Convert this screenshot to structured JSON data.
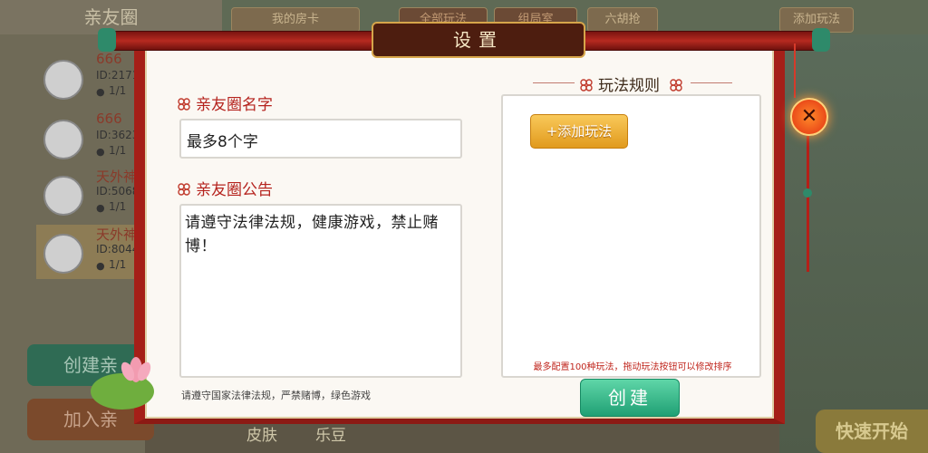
{
  "background": {
    "left_header": "亲友圈",
    "top_tabs": [
      "我的房卡",
      "全部玩法",
      "组局室",
      "六胡抢",
      "添加玩法"
    ],
    "members": [
      {
        "name": "666",
        "id": "ID:2171",
        "count": "1/1"
      },
      {
        "name": "666",
        "id": "ID:3623",
        "count": "1/1"
      },
      {
        "name": "天外神",
        "id": "ID:5068",
        "count": "1/1"
      },
      {
        "name": "天外神",
        "id": "ID:8044",
        "count": "1/1"
      }
    ],
    "create_circle_label": "创建亲",
    "join_circle_label": "加入亲",
    "bottom_labels": [
      "皮肤",
      "乐豆"
    ],
    "quick_start_label": "快速开始"
  },
  "dialog": {
    "title": "设置",
    "name_label": "亲友圈名字",
    "name_placeholder": "最多8个字",
    "notice_label": "亲友圈公告",
    "notice_text": "请遵守法律法规，健康游戏，禁止赌博！",
    "footnote": "请遵守国家法律法规，严禁赌博，绿色游戏",
    "rules_title": "玩法规则",
    "add_rule_label": "+添加玩法",
    "rules_note": "最多配置100种玩法，拖动玩法按钮可以修改排序",
    "create_button": "创建",
    "close_symbol": "✕"
  },
  "colors": {
    "frame_red": "#a51f18",
    "label_red": "#b5231e",
    "create_green": "#20a074",
    "add_orange": "#e19a1d"
  },
  "icons": [
    "close-icon",
    "ornament-icon",
    "person-icon",
    "avatar",
    "lotus-decoration"
  ]
}
